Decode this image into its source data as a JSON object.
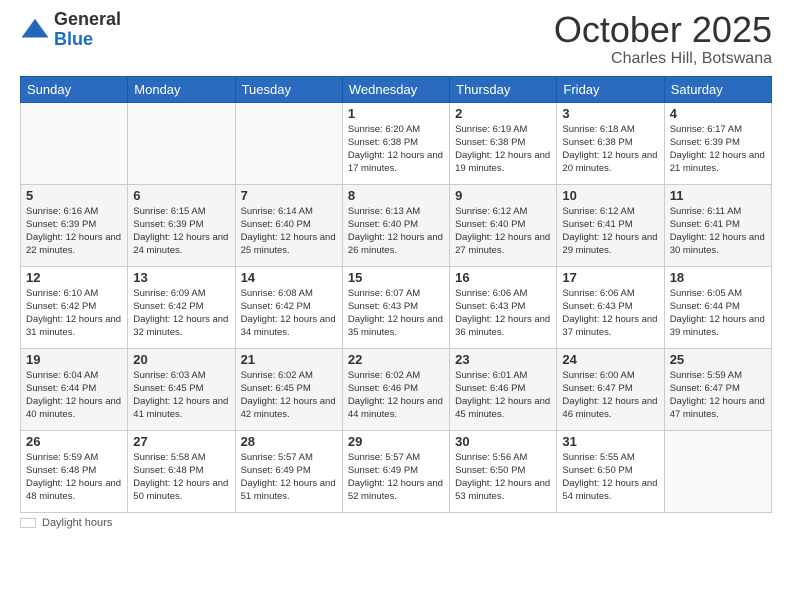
{
  "logo": {
    "general": "General",
    "blue": "Blue"
  },
  "header": {
    "month": "October 2025",
    "location": "Charles Hill, Botswana"
  },
  "weekdays": [
    "Sunday",
    "Monday",
    "Tuesday",
    "Wednesday",
    "Thursday",
    "Friday",
    "Saturday"
  ],
  "weeks": [
    [
      {
        "day": "",
        "info": ""
      },
      {
        "day": "",
        "info": ""
      },
      {
        "day": "",
        "info": ""
      },
      {
        "day": "1",
        "info": "Sunrise: 6:20 AM\nSunset: 6:38 PM\nDaylight: 12 hours\nand 17 minutes."
      },
      {
        "day": "2",
        "info": "Sunrise: 6:19 AM\nSunset: 6:38 PM\nDaylight: 12 hours\nand 19 minutes."
      },
      {
        "day": "3",
        "info": "Sunrise: 6:18 AM\nSunset: 6:38 PM\nDaylight: 12 hours\nand 20 minutes."
      },
      {
        "day": "4",
        "info": "Sunrise: 6:17 AM\nSunset: 6:39 PM\nDaylight: 12 hours\nand 21 minutes."
      }
    ],
    [
      {
        "day": "5",
        "info": "Sunrise: 6:16 AM\nSunset: 6:39 PM\nDaylight: 12 hours\nand 22 minutes."
      },
      {
        "day": "6",
        "info": "Sunrise: 6:15 AM\nSunset: 6:39 PM\nDaylight: 12 hours\nand 24 minutes."
      },
      {
        "day": "7",
        "info": "Sunrise: 6:14 AM\nSunset: 6:40 PM\nDaylight: 12 hours\nand 25 minutes."
      },
      {
        "day": "8",
        "info": "Sunrise: 6:13 AM\nSunset: 6:40 PM\nDaylight: 12 hours\nand 26 minutes."
      },
      {
        "day": "9",
        "info": "Sunrise: 6:12 AM\nSunset: 6:40 PM\nDaylight: 12 hours\nand 27 minutes."
      },
      {
        "day": "10",
        "info": "Sunrise: 6:12 AM\nSunset: 6:41 PM\nDaylight: 12 hours\nand 29 minutes."
      },
      {
        "day": "11",
        "info": "Sunrise: 6:11 AM\nSunset: 6:41 PM\nDaylight: 12 hours\nand 30 minutes."
      }
    ],
    [
      {
        "day": "12",
        "info": "Sunrise: 6:10 AM\nSunset: 6:42 PM\nDaylight: 12 hours\nand 31 minutes."
      },
      {
        "day": "13",
        "info": "Sunrise: 6:09 AM\nSunset: 6:42 PM\nDaylight: 12 hours\nand 32 minutes."
      },
      {
        "day": "14",
        "info": "Sunrise: 6:08 AM\nSunset: 6:42 PM\nDaylight: 12 hours\nand 34 minutes."
      },
      {
        "day": "15",
        "info": "Sunrise: 6:07 AM\nSunset: 6:43 PM\nDaylight: 12 hours\nand 35 minutes."
      },
      {
        "day": "16",
        "info": "Sunrise: 6:06 AM\nSunset: 6:43 PM\nDaylight: 12 hours\nand 36 minutes."
      },
      {
        "day": "17",
        "info": "Sunrise: 6:06 AM\nSunset: 6:43 PM\nDaylight: 12 hours\nand 37 minutes."
      },
      {
        "day": "18",
        "info": "Sunrise: 6:05 AM\nSunset: 6:44 PM\nDaylight: 12 hours\nand 39 minutes."
      }
    ],
    [
      {
        "day": "19",
        "info": "Sunrise: 6:04 AM\nSunset: 6:44 PM\nDaylight: 12 hours\nand 40 minutes."
      },
      {
        "day": "20",
        "info": "Sunrise: 6:03 AM\nSunset: 6:45 PM\nDaylight: 12 hours\nand 41 minutes."
      },
      {
        "day": "21",
        "info": "Sunrise: 6:02 AM\nSunset: 6:45 PM\nDaylight: 12 hours\nand 42 minutes."
      },
      {
        "day": "22",
        "info": "Sunrise: 6:02 AM\nSunset: 6:46 PM\nDaylight: 12 hours\nand 44 minutes."
      },
      {
        "day": "23",
        "info": "Sunrise: 6:01 AM\nSunset: 6:46 PM\nDaylight: 12 hours\nand 45 minutes."
      },
      {
        "day": "24",
        "info": "Sunrise: 6:00 AM\nSunset: 6:47 PM\nDaylight: 12 hours\nand 46 minutes."
      },
      {
        "day": "25",
        "info": "Sunrise: 5:59 AM\nSunset: 6:47 PM\nDaylight: 12 hours\nand 47 minutes."
      }
    ],
    [
      {
        "day": "26",
        "info": "Sunrise: 5:59 AM\nSunset: 6:48 PM\nDaylight: 12 hours\nand 48 minutes."
      },
      {
        "day": "27",
        "info": "Sunrise: 5:58 AM\nSunset: 6:48 PM\nDaylight: 12 hours\nand 50 minutes."
      },
      {
        "day": "28",
        "info": "Sunrise: 5:57 AM\nSunset: 6:49 PM\nDaylight: 12 hours\nand 51 minutes."
      },
      {
        "day": "29",
        "info": "Sunrise: 5:57 AM\nSunset: 6:49 PM\nDaylight: 12 hours\nand 52 minutes."
      },
      {
        "day": "30",
        "info": "Sunrise: 5:56 AM\nSunset: 6:50 PM\nDaylight: 12 hours\nand 53 minutes."
      },
      {
        "day": "31",
        "info": "Sunrise: 5:55 AM\nSunset: 6:50 PM\nDaylight: 12 hours\nand 54 minutes."
      },
      {
        "day": "",
        "info": ""
      }
    ]
  ],
  "legend": {
    "label": "Daylight hours"
  }
}
